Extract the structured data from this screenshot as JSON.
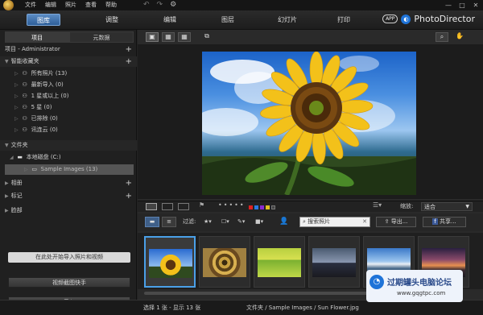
{
  "titlebar": {
    "menus": [
      "文件",
      "编辑",
      "照片",
      "查看",
      "帮助"
    ]
  },
  "modebar": {
    "tabs": [
      "图库",
      "调整",
      "编辑",
      "图层",
      "幻灯片",
      "打印"
    ],
    "app_badge": "APP",
    "brand_name": "PhotoDirector"
  },
  "left_panel": {
    "tabs": [
      "项目",
      "元数据"
    ],
    "project_header": "项目 - Administrator",
    "smart_header": "智能收藏夹",
    "smart_items": [
      "所有照片 (13)",
      "最新导入 (0)",
      "1 星或以上 (0)",
      "5 星 (0)",
      "已排除 (0)",
      "讯连云 (0)"
    ],
    "folder_header": "文件夹",
    "drive": "本地磁盘 (C:)",
    "folder": "Sample Images (13)",
    "album_header": "相册",
    "tag_header": "标记",
    "face_header": "脸部",
    "import_hint": "在此处开始导入照片和视频",
    "video_button": "视频截图快手",
    "import_button": "导入"
  },
  "viewer": {
    "filter_label": "过滤:",
    "zoom_label": "缩放:",
    "zoom_value": "适合",
    "search_placeholder": "搜索照片",
    "export_label": "导出...",
    "share_label": "共享...",
    "color_labels": [
      "#e02020",
      "#2a7be0",
      "#8a2ad0",
      "#e0c020",
      "#444444"
    ]
  },
  "status": {
    "left": "选择 1 张 - 显示 13 张",
    "path": "文件夹 / Sample Images / Sun Flower.jpg"
  },
  "watermark": {
    "title": "过期罐头电脑论坛",
    "url": "www.gqgtpc.com"
  }
}
